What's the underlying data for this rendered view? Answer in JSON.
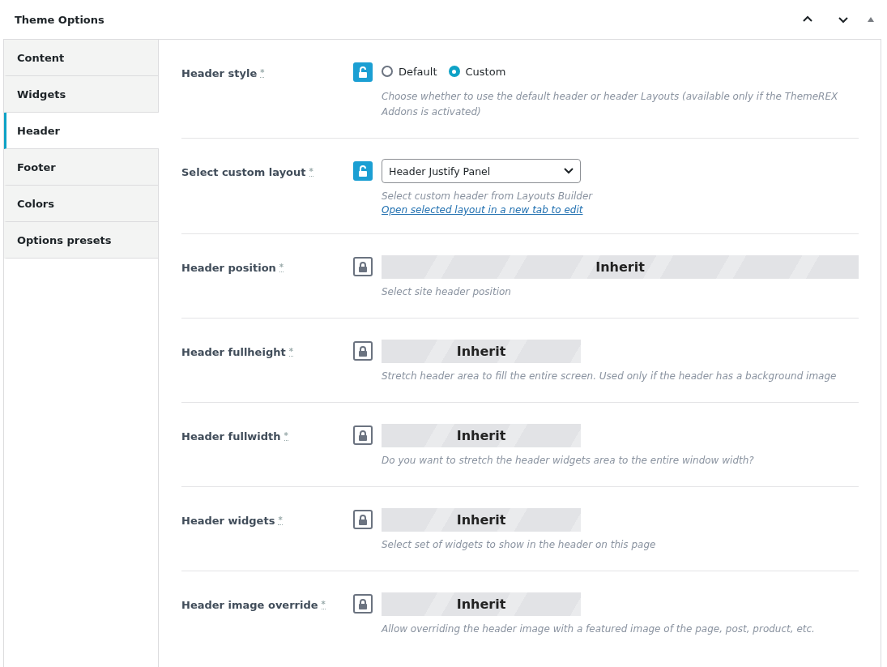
{
  "panel": {
    "title": "Theme Options",
    "controls": [
      {
        "kind": "up"
      },
      {
        "kind": "down"
      },
      {
        "kind": "collapse"
      }
    ]
  },
  "tabs": [
    {
      "label": "Content",
      "selected": false
    },
    {
      "label": "Widgets",
      "selected": false
    },
    {
      "label": "Header",
      "selected": true
    },
    {
      "label": "Footer",
      "selected": false
    },
    {
      "label": "Colors",
      "selected": false
    },
    {
      "label": "Options presets",
      "selected": false
    }
  ],
  "options": [
    {
      "kind": "radio",
      "label": "Header style",
      "mark": "*",
      "locked": false,
      "choices": [
        {
          "label": "Default",
          "selected": false
        },
        {
          "label": "Custom",
          "selected": true
        }
      ],
      "description": "Choose whether to use the default header or header Layouts (available only if the ThemeREX Addons is activated)"
    },
    {
      "kind": "select",
      "label": "Select custom layout",
      "mark": "*",
      "locked": false,
      "value": "Header Justify Panel",
      "description": "Select custom header from Layouts Builder",
      "link": "Open selected layout in a new tab to edit"
    },
    {
      "kind": "inherit",
      "label": "Header position",
      "mark": "*",
      "locked": true,
      "wide": true,
      "value": "Inherit",
      "description": "Select site header position"
    },
    {
      "kind": "inherit",
      "label": "Header fullheight",
      "mark": "*",
      "locked": true,
      "wide": false,
      "value": "Inherit",
      "description": "Stretch header area to fill the entire screen. Used only if the header has a background image"
    },
    {
      "kind": "inherit",
      "label": "Header fullwidth",
      "mark": "*",
      "locked": true,
      "wide": false,
      "value": "Inherit",
      "description": "Do you want to stretch the header widgets area to the entire window width?"
    },
    {
      "kind": "inherit",
      "label": "Header widgets",
      "mark": "*",
      "locked": true,
      "wide": false,
      "value": "Inherit",
      "description": "Select set of widgets to show in the header on this page"
    },
    {
      "kind": "inherit",
      "label": "Header image override",
      "mark": "*",
      "locked": true,
      "wide": false,
      "value": "Inherit",
      "description": "Allow overriding the header image with a featured image of the page, post, product, etc."
    }
  ]
}
